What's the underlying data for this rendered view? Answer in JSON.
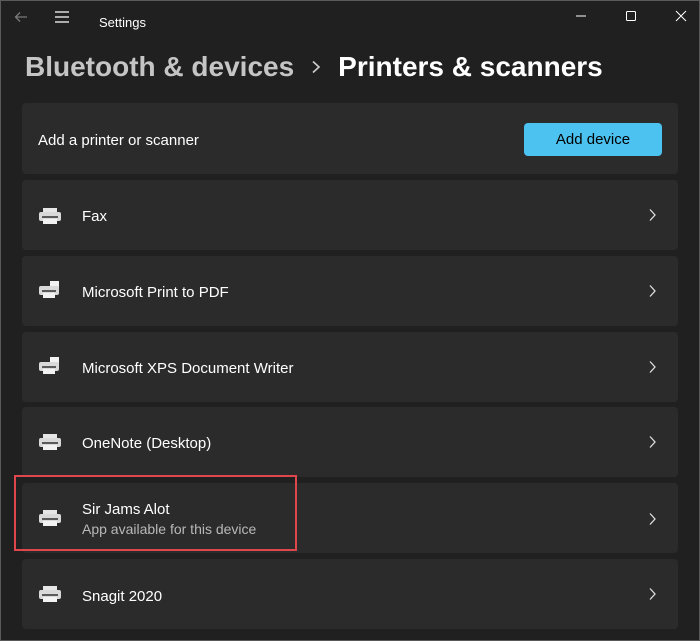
{
  "window": {
    "title": "Settings",
    "icons": {
      "back": "back-arrow-icon",
      "menu": "hamburger-menu-icon",
      "minimize": "minimize-icon",
      "maximize": "maximize-icon",
      "close": "close-icon"
    }
  },
  "breadcrumb": {
    "parent": "Bluetooth & devices",
    "separator_icon": "chevron-right-icon",
    "current": "Printers & scanners"
  },
  "add_section": {
    "label": "Add a printer or scanner",
    "button_label": "Add device"
  },
  "devices": [
    {
      "name": "Fax",
      "subtitle": "",
      "icon": "printer-icon"
    },
    {
      "name": "Microsoft Print to PDF",
      "subtitle": "",
      "icon": "virtual-printer-icon"
    },
    {
      "name": "Microsoft XPS Document Writer",
      "subtitle": "",
      "icon": "virtual-printer-icon"
    },
    {
      "name": "OneNote (Desktop)",
      "subtitle": "",
      "icon": "printer-icon"
    },
    {
      "name": "Sir Jams Alot",
      "subtitle": "App available for this device",
      "icon": "printer-icon"
    },
    {
      "name": "Snagit 2020",
      "subtitle": "",
      "icon": "printer-icon"
    }
  ],
  "colors": {
    "background": "#202020",
    "card": "#2b2b2b",
    "accent": "#4cc2f0",
    "highlight": "#e0474c"
  }
}
